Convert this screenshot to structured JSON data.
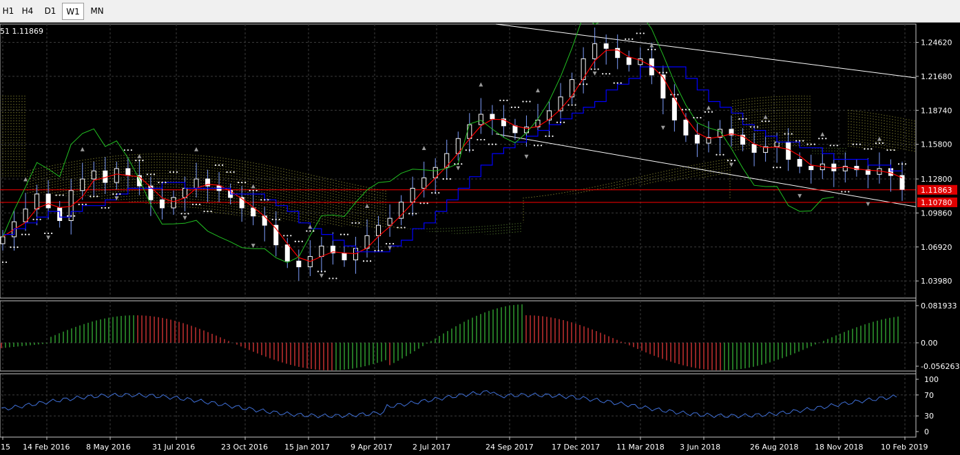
{
  "toolbar": {
    "timeframes": [
      {
        "label": "H1",
        "active": false
      },
      {
        "label": "H4",
        "active": false
      },
      {
        "label": "D1",
        "active": false
      },
      {
        "label": "W1",
        "active": true
      },
      {
        "label": "MN",
        "active": false
      }
    ]
  },
  "info_line": "51 1.11869",
  "price_axis": {
    "ticks": [
      "1.24620",
      "1.21680",
      "1.18740",
      "1.15800",
      "1.12800",
      "1.09860",
      "1.06920",
      "1.03980"
    ],
    "tag_current": "1.11863",
    "tag_level": "1.10780"
  },
  "oscillator_axis": {
    "ticks": [
      "0.081933",
      "0.00",
      "-0.056263"
    ]
  },
  "rsi_axis": {
    "ticks": [
      "100",
      "70",
      "30",
      "0"
    ]
  },
  "time_axis": {
    "labels": [
      "15",
      "14 Feb 2016",
      "8 May 2016",
      "31 Jul 2016",
      "23 Oct 2016",
      "15 Jan 2017",
      "9 Apr 2017",
      "2 Jul 2017",
      "24 Sep 2017",
      "17 Dec 2017",
      "11 Mar 2018",
      "3 Jun 2018",
      "26 Aug 2018",
      "18 Nov 2018",
      "10 Feb 2019"
    ]
  },
  "colors": {
    "background": "#000000",
    "grid": "#3c3c3c",
    "bull_candle": "#ffffff",
    "bear_candle": "#ffffff",
    "fast_ma": "#ff0000",
    "slow_ma": "#0000ff",
    "chikou": "#22c022",
    "kumo_up": "#d8d84c",
    "kumo_down": "#86c24a",
    "parabolic_sar": "#ffffff",
    "level_line": "#ff0000",
    "histogram_up": "#2f9a2f",
    "histogram_down": "#c43030",
    "rsi_line": "#3f6fd6"
  },
  "chart_data": {
    "type": "line",
    "series": [
      {
        "values": [
          1.078,
          1.091,
          1.102,
          1.115,
          1.103,
          1.092,
          1.118,
          1.128,
          1.135,
          1.125,
          1.137,
          1.131,
          1.122,
          1.11,
          1.103,
          1.112,
          1.12,
          1.128,
          1.122,
          1.118,
          1.112,
          1.103,
          1.096,
          1.088,
          1.071,
          1.057,
          1.052,
          1.061,
          1.07,
          1.064,
          1.058,
          1.068,
          1.079,
          1.088,
          1.094,
          1.108,
          1.12,
          1.129,
          1.138,
          1.15,
          1.163,
          1.175,
          1.184,
          1.18,
          1.174,
          1.168,
          1.173,
          1.179,
          1.187,
          1.199,
          1.214,
          1.232,
          1.245,
          1.241,
          1.233,
          1.227,
          1.232,
          1.218,
          1.198,
          1.179,
          1.166,
          1.159,
          1.164,
          1.171,
          1.166,
          1.158,
          1.151,
          1.156,
          1.16,
          1.145,
          1.139,
          1.136,
          1.141,
          1.135,
          1.139,
          1.136,
          1.132,
          1.137,
          1.131,
          1.119
        ]
      }
    ],
    "ylim": [
      1.025,
      1.262
    ]
  }
}
